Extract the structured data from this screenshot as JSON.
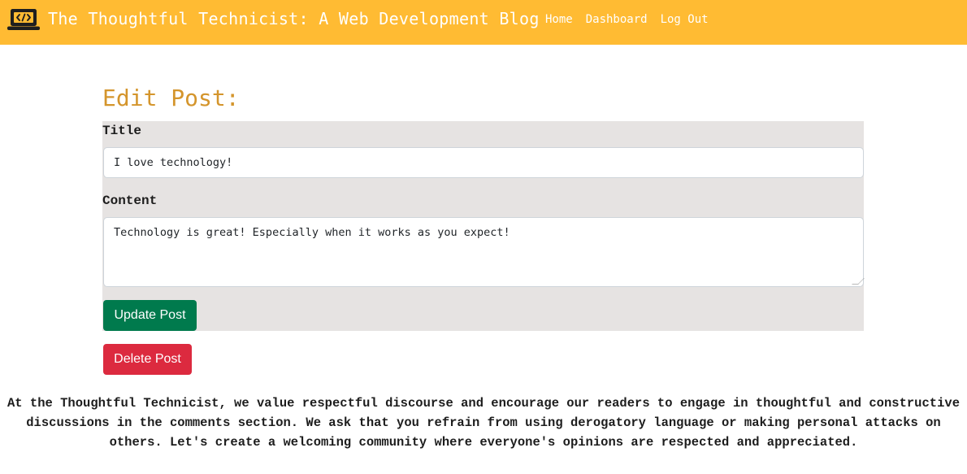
{
  "navbar": {
    "logo_icon": "laptop-code-icon",
    "brand": "The Thoughtful Technicist: A Web Development Blog",
    "links": [
      "Home",
      "Dashboard",
      "Log Out"
    ],
    "background": "#ffbb33"
  },
  "page": {
    "title": "Edit Post:"
  },
  "form": {
    "title_label": "Title",
    "title_value": "I love technology!",
    "content_label": "Content",
    "content_value": "Technology is great! Especially when it works as you expect!",
    "update_label": "Update Post",
    "delete_label": "Delete Post"
  },
  "footer": {
    "message": "At the Thoughtful Technicist, we value respectful discourse and encourage our readers to engage in thoughtful and constructive discussions in the comments section. We ask that you refrain from using derogatory language or making personal attacks on others. Let's create a welcoming community where everyone's opinions are respected and appreciated."
  },
  "colors": {
    "accent": "#d4952c",
    "update": "#007a4d",
    "delete": "#dc2a3f",
    "panel": "#e6e3e2"
  }
}
